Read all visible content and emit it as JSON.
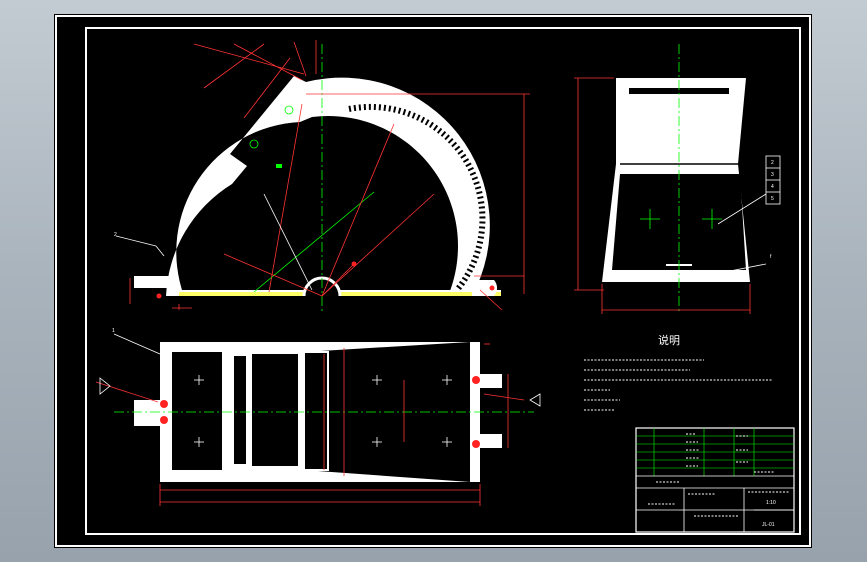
{
  "drawing": {
    "notes_title": "说明",
    "labels": {
      "arch_part": "2",
      "base_part": "1",
      "side_part": "f"
    },
    "side_view_callouts": [
      "2",
      "3",
      "4",
      "5"
    ],
    "title_block": {
      "scale": "1:10",
      "drawing_no": "JL-01"
    }
  }
}
